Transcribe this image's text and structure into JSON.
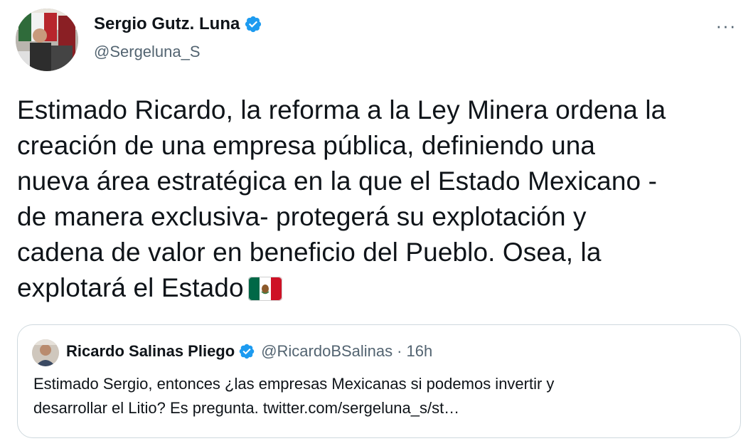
{
  "tweet": {
    "author": {
      "name": "Sergio Gutz. Luna",
      "handle": "@Sergeluna_S",
      "verified": true
    },
    "more_menu": "···",
    "text_lines": [
      "Estimado Ricardo, la reforma a la Ley Minera ordena la",
      "creación de una empresa pública, definiendo una",
      "nueva área estratégica en la que el Estado Mexicano -",
      "de manera exclusiva- protegerá su explotación y",
      "cadena de valor en beneficio del Pueblo. Osea, la",
      "explotará el Estado"
    ],
    "emoji": "mexico-flag"
  },
  "quoted_tweet": {
    "name": "Ricardo Salinas Pliego",
    "verified": true,
    "handle": "@RicardoBSalinas",
    "separator": "·",
    "time": "16h",
    "text_lines": [
      "Estimado Sergio, entonces ¿las empresas Mexicanas si podemos invertir y",
      "desarrollar el Litio? Es pregunta. twitter.com/sergeluna_s/st…"
    ]
  },
  "colors": {
    "verified_blue": "#1d9bf0",
    "secondary_text": "#536471",
    "primary_text": "#0f1419",
    "border": "#cfd9de"
  }
}
